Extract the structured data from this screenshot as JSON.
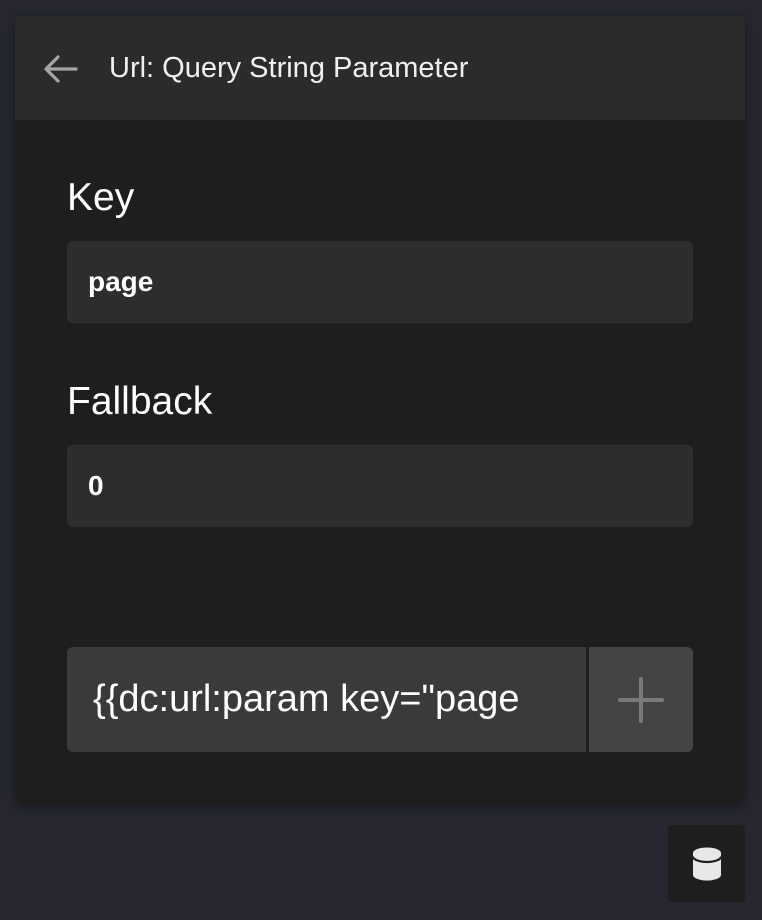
{
  "header": {
    "title": "Url: Query String Parameter",
    "back_icon": "arrow-left-icon"
  },
  "fields": {
    "key": {
      "label": "Key",
      "value": "page"
    },
    "fallback": {
      "label": "Fallback",
      "value": "0"
    }
  },
  "shortcode": {
    "text": "{{dc:url:param key=\"page",
    "insert_icon": "plus-icon"
  },
  "dynamic_content": {
    "icon": "database-icon"
  },
  "colors": {
    "background": "#262730",
    "panel": "#1e1e1e",
    "header": "#2b2b2b",
    "input": "#2d2d2d",
    "shortcode": "#3a3a3a",
    "insert_button": "#444444"
  }
}
